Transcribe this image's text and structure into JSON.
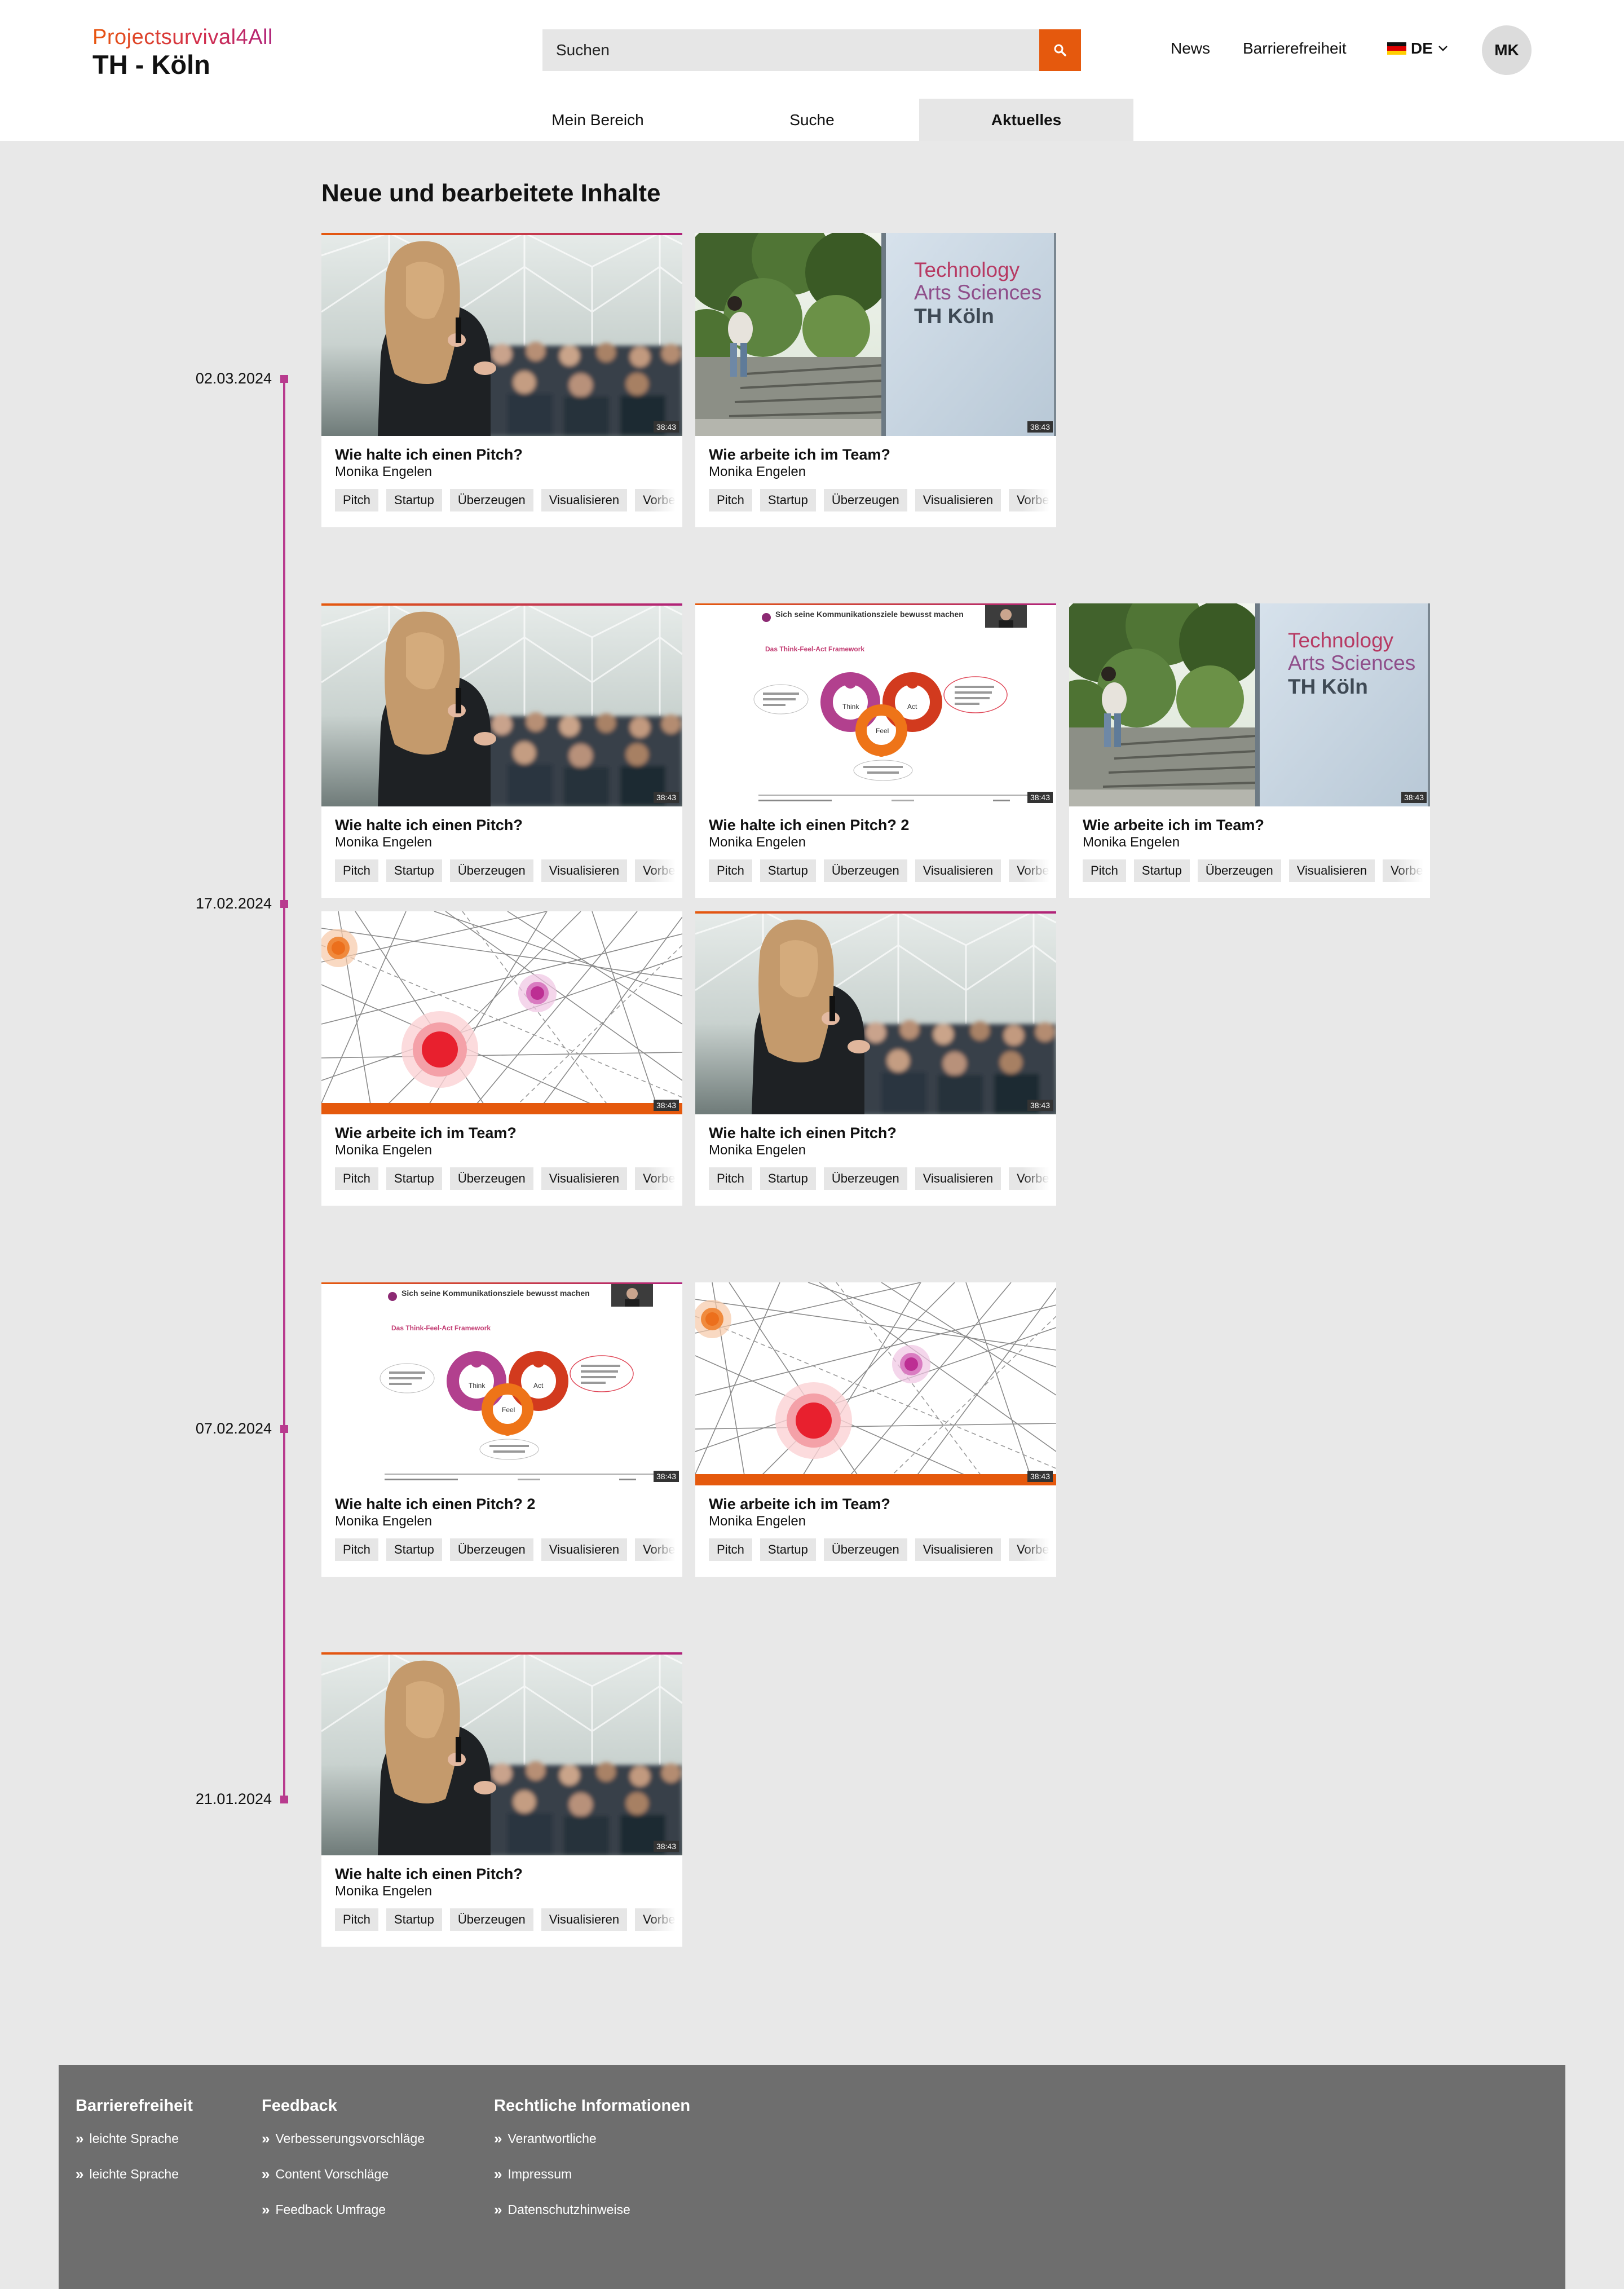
{
  "header": {
    "logo_line1": "Projectsurvival4All",
    "logo_line2": "TH - Köln",
    "search_placeholder": "Suchen",
    "links": [
      "News",
      "Barrierefreiheit"
    ],
    "language": "DE",
    "avatar_initials": "MK"
  },
  "tabs": [
    {
      "label": "Mein Bereich",
      "active": false
    },
    {
      "label": "Suche",
      "active": false
    },
    {
      "label": "Aktuelles",
      "active": true
    }
  ],
  "main": {
    "title": "Neue und bearbeitete Inhalte",
    "timeline_dates": [
      "02.03.2024",
      "17.02.2024",
      "07.02.2024",
      "21.01.2024"
    ]
  },
  "tags": [
    "Pitch",
    "Startup",
    "Überzeugen",
    "Visualisieren",
    "Vorbereitung"
  ],
  "cards": [
    {
      "title": "Wie halte ich einen Pitch?",
      "author": "Monika Engelen",
      "duration": "38:43",
      "thumb": "speaker-photo"
    },
    {
      "title": "Wie arbeite ich im Team?",
      "author": "Monika Engelen",
      "duration": "38:43",
      "thumb": "campus-photo"
    },
    {
      "title": "Wie halte ich einen Pitch?",
      "author": "Monika Engelen",
      "duration": "38:43",
      "thumb": "speaker-photo"
    },
    {
      "title": "Wie halte ich einen Pitch? 2",
      "author": "Monika Engelen",
      "duration": "38:43",
      "thumb": "slide-think-feel-act"
    },
    {
      "title": "Wie arbeite ich im Team?",
      "author": "Monika Engelen",
      "duration": "38:43",
      "thumb": "campus-photo"
    },
    {
      "title": "Wie arbeite ich im Team?",
      "author": "Monika Engelen",
      "duration": "38:43",
      "thumb": "network-graphic"
    },
    {
      "title": "Wie halte ich einen Pitch?",
      "author": "Monika Engelen",
      "duration": "38:43",
      "thumb": "speaker-photo"
    },
    {
      "title": "Wie halte ich einen Pitch? 2",
      "author": "Monika Engelen",
      "duration": "38:43",
      "thumb": "slide-think-feel-act"
    },
    {
      "title": "Wie arbeite ich im Team?",
      "author": "Monika Engelen",
      "duration": "38:43",
      "thumb": "network-graphic"
    },
    {
      "title": "Wie halte ich einen Pitch?",
      "author": "Monika Engelen",
      "duration": "38:43",
      "thumb": "speaker-photo"
    }
  ],
  "thumb_text": {
    "campus_sign": [
      "Technology",
      "Arts Sciences",
      "TH Köln"
    ],
    "slide_heading": "Sich seine Kommunikationsziele bewusst machen",
    "slide_subheading": "Das Think-Feel-Act Framework",
    "slide_labels": [
      "Think",
      "Feel",
      "Act"
    ]
  },
  "footer": {
    "columns": [
      {
        "heading": "Barrierefreiheit",
        "links": [
          "leichte Sprache",
          "leichte Sprache"
        ]
      },
      {
        "heading": "Feedback",
        "links": [
          "Verbesserungsvorschläge",
          "Content Vorschläge",
          "Feedback Umfrage"
        ]
      },
      {
        "heading": "Rechtliche Informationen",
        "links": [
          "Verantwortliche",
          "Impressum",
          "Datenschutzhinweise"
        ]
      }
    ]
  },
  "colors": {
    "accent_orange": "#e5590d",
    "timeline_magenta": "#b83b8e",
    "footer_grey": "#6e6e6e"
  }
}
